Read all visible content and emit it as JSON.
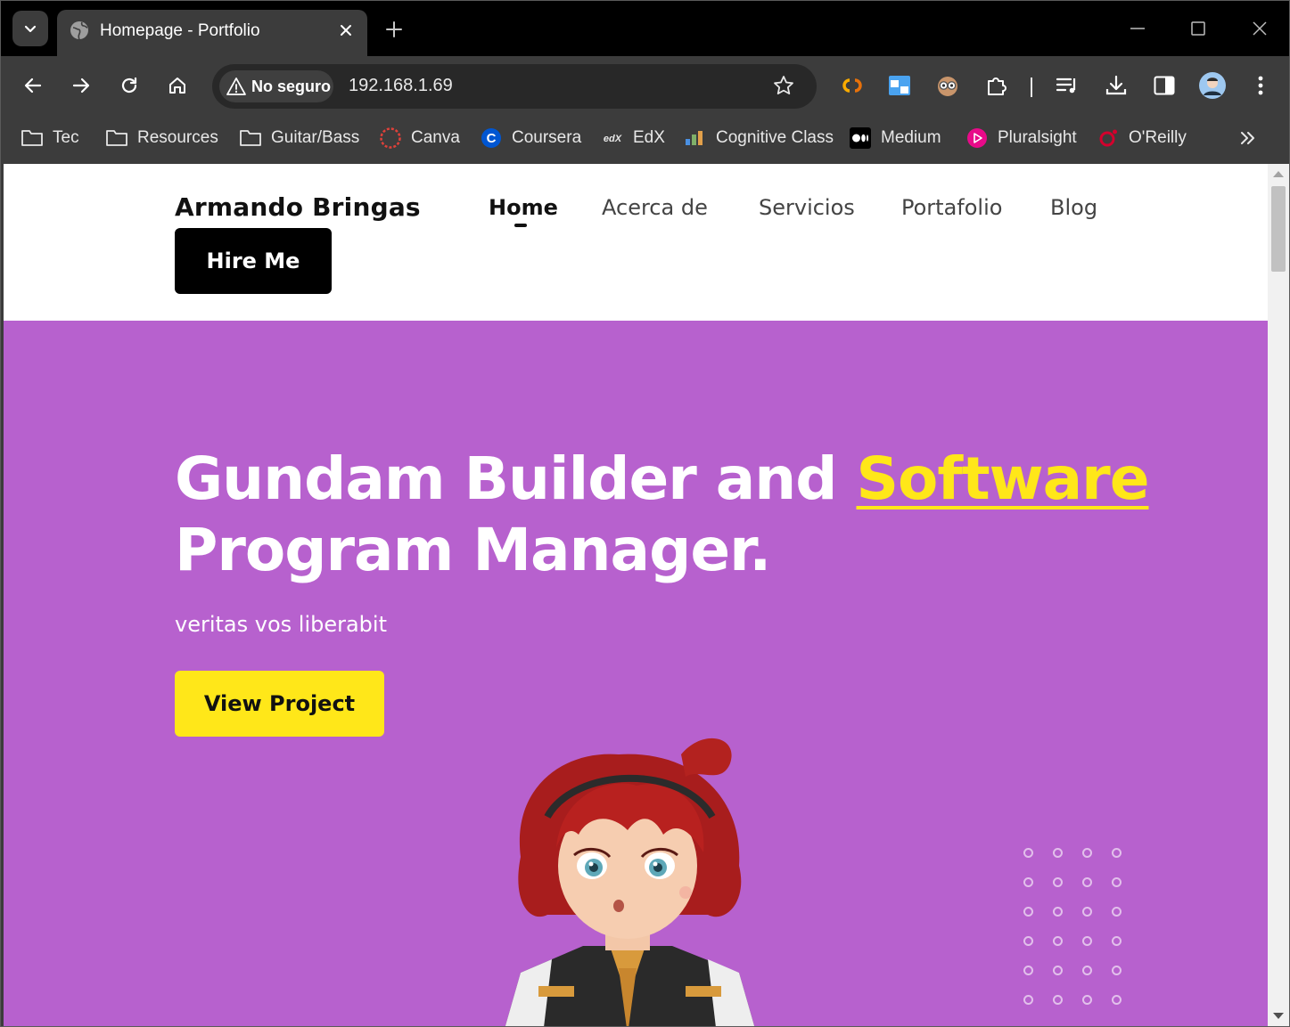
{
  "browser": {
    "tab": {
      "title": "Homepage - Portfolio"
    },
    "omnibox": {
      "security_label": "No seguro",
      "url": "192.168.1.69"
    },
    "bookmarks": [
      {
        "label": "Tec",
        "icon": "folder-icon"
      },
      {
        "label": "Resources",
        "icon": "folder-icon"
      },
      {
        "label": "Guitar/Bass",
        "icon": "folder-icon"
      },
      {
        "label": "Canva",
        "icon": "canva-icon"
      },
      {
        "label": "Coursera",
        "icon": "coursera-icon"
      },
      {
        "label": "EdX",
        "icon": "edx-icon"
      },
      {
        "label": "Cognitive Class",
        "icon": "cognitive-class-icon"
      },
      {
        "label": "Medium",
        "icon": "medium-icon"
      },
      {
        "label": "Pluralsight",
        "icon": "pluralsight-icon"
      },
      {
        "label": "O'Reilly",
        "icon": "oreilly-icon"
      }
    ],
    "extensions": [
      "colab-icon",
      "window-extension-icon",
      "owl-extension-icon",
      "puzzle-icon",
      "reading-list-icon",
      "download-icon",
      "side-panel-icon",
      "profile-avatar-icon",
      "menu-icon"
    ]
  },
  "site": {
    "brand": "Armando Bringas",
    "nav": [
      {
        "label": "Home",
        "active": true
      },
      {
        "label": "Acerca de"
      },
      {
        "label": "Servicios"
      },
      {
        "label": "Portafolio"
      },
      {
        "label": "Blog"
      }
    ],
    "hire_label": "Hire Me",
    "hero": {
      "title_part1": "Gundam Builder and ",
      "title_highlight": "Software",
      "title_part2": "Program Manager.",
      "subtitle": "veritas vos liberabit",
      "cta_label": "View Project"
    }
  },
  "colors": {
    "hero_bg": "#b761ce",
    "accent_yellow": "#ffe719",
    "dark": "#000000"
  }
}
